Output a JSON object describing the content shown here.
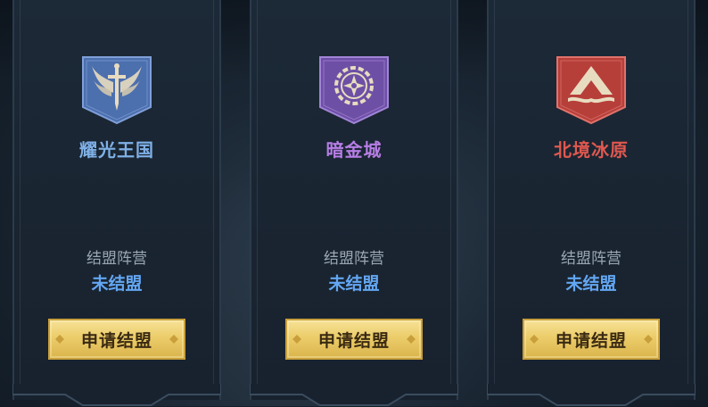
{
  "factions": [
    {
      "name": "耀光王国",
      "name_color": "#7fb0e6",
      "emblem_icon": "winged-sword-icon",
      "emblem_color": "#4c6fae",
      "alliance_label": "结盟阵营",
      "alliance_value": "未结盟",
      "button_label": "申请结盟"
    },
    {
      "name": "暗金城",
      "name_color": "#b77ee6",
      "emblem_icon": "gear-compass-icon",
      "emblem_color": "#6e4fa6",
      "alliance_label": "结盟阵营",
      "alliance_value": "未结盟",
      "button_label": "申请结盟"
    },
    {
      "name": "北境冰原",
      "name_color": "#e0584f",
      "emblem_icon": "mountain-peak-icon",
      "emblem_color": "#b73f3a",
      "alliance_label": "结盟阵营",
      "alliance_value": "未结盟",
      "button_label": "申请结盟"
    }
  ]
}
